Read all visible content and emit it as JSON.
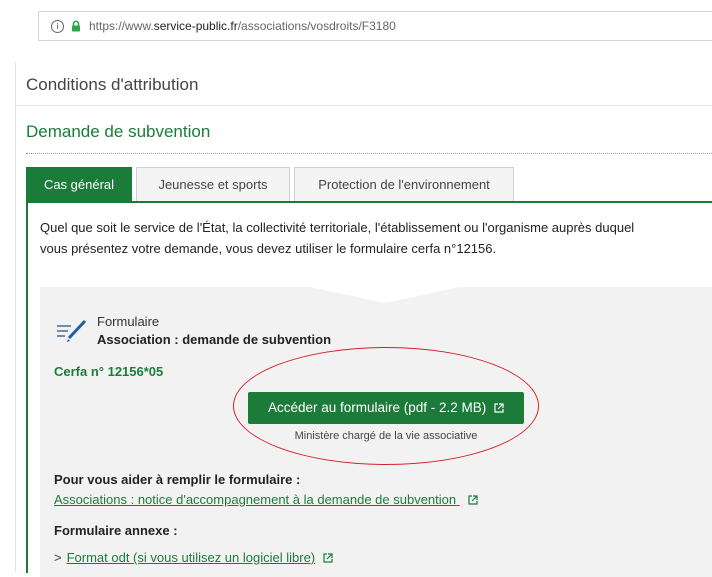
{
  "browser": {
    "url_prefix": "https://www.",
    "url_domain": "service-public.fr",
    "url_path": "/associations/vosdroits/F3180",
    "info_glyph": "i"
  },
  "sections": {
    "conditions_title": "Conditions d'attribution",
    "demande_title": "Demande de subvention"
  },
  "tabs": [
    {
      "label": "Cas général",
      "active": true
    },
    {
      "label": "Jeunesse et sports",
      "active": false
    },
    {
      "label": "Protection de l'environnement",
      "active": false
    }
  ],
  "content": {
    "intro_line1": "Quel que soit le service de l'État, la collectivité territoriale, l'établissement ou l'organisme auprès duquel",
    "intro_line2": "vous présentez votre demande, vous devez utiliser le formulaire cerfa n°12156.",
    "form_kind": "Formulaire",
    "form_title": "Association : demande de subvention",
    "cerfa": "Cerfa n° 12156*05",
    "button_label": "Accéder au formulaire (pdf - 2.2 MB)",
    "ministry": "Ministère chargé de la vie associative",
    "help_title": "Pour vous aider à remplir le formulaire :",
    "help_link": "Associations : notice d'accompagnement à la demande de subvention",
    "annex_title": "Formulaire annexe :",
    "annex_chevron": ">",
    "annex_link": "Format odt (si vous utilisez un logiciel libre)"
  },
  "colors": {
    "brand_green": "#1b7c3a",
    "highlight_red": "#d8202c"
  },
  "icons": [
    "info-icon",
    "lock-icon",
    "form-pen-icon",
    "external-link-icon"
  ]
}
